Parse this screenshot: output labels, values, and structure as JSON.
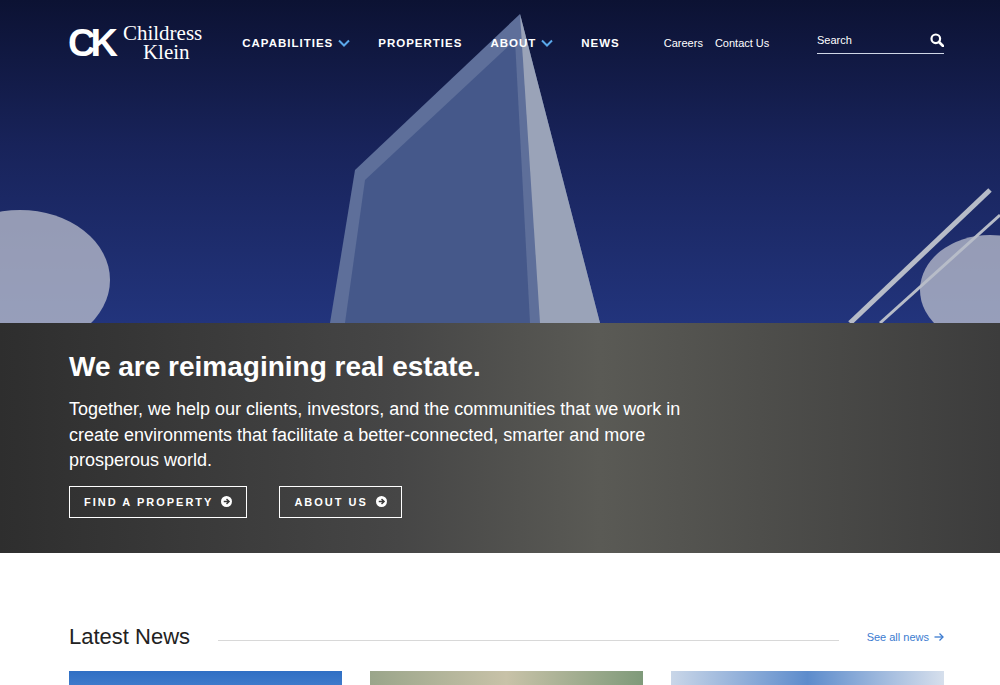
{
  "logo": {
    "mark": "CK",
    "line1": "Childress",
    "line2": "Klein"
  },
  "nav": [
    {
      "label": "CAPABILITIES",
      "dropdown": true
    },
    {
      "label": "PROPERTIES",
      "dropdown": false
    },
    {
      "label": "ABOUT",
      "dropdown": true
    },
    {
      "label": "NEWS",
      "dropdown": false
    }
  ],
  "utility": [
    "Careers",
    "Contact Us"
  ],
  "search": {
    "placeholder": "Search"
  },
  "hero": {
    "title": "We are reimagining real estate.",
    "body": "Together, we help our clients, investors, and the communities that we work in create environments that facilitate a better-connected, smarter and more prosperous world.",
    "buttons": [
      "FIND A PROPERTY",
      "ABOUT US"
    ]
  },
  "news": {
    "title": "Latest News",
    "link": "See all news"
  }
}
